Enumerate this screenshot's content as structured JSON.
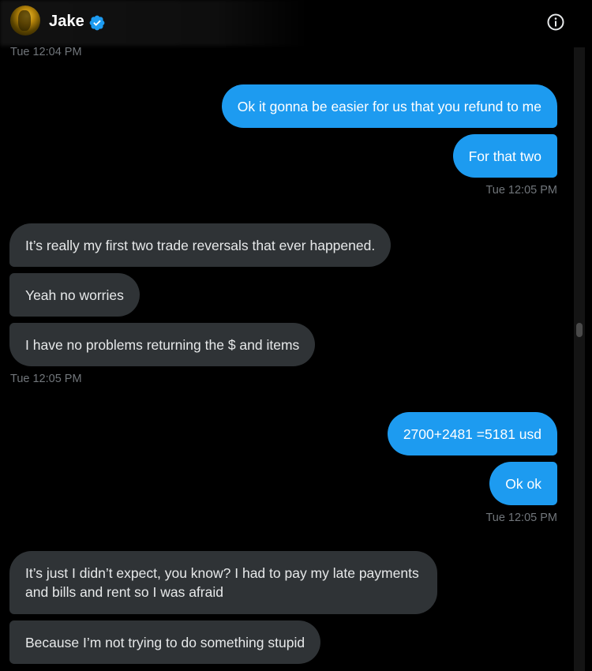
{
  "header": {
    "name": "Jake",
    "verified_icon": "verified-badge-icon",
    "info_icon": "info-icon"
  },
  "colors": {
    "background": "#000000",
    "sent_bubble": "#1d9bf0",
    "received_bubble": "#2f3336",
    "timestamp": "#71767b",
    "verified": "#1d9bf0"
  },
  "conversation": {
    "timestamp_top": "Tue 12:04 PM",
    "sent_1": "Ok it gonna be easier for us that you refund to me",
    "sent_2": "For that two",
    "timestamp_sent_1": "Tue 12:05 PM",
    "recv_1": "It’s really my first two trade reversals that ever happened.",
    "recv_2": "Yeah no worries",
    "recv_3": "I have no problems returning the $ and items",
    "timestamp_recv_1": "Tue 12:05 PM",
    "sent_3": "2700+2481 =5181 usd",
    "sent_4": "Ok ok",
    "timestamp_sent_2": "Tue 12:05 PM",
    "recv_4": "It’s just I didn’t expect, you know? I had to pay my late payments and bills and rent so I was afraid",
    "recv_5": "Because I’m not trying to do something stupid"
  }
}
